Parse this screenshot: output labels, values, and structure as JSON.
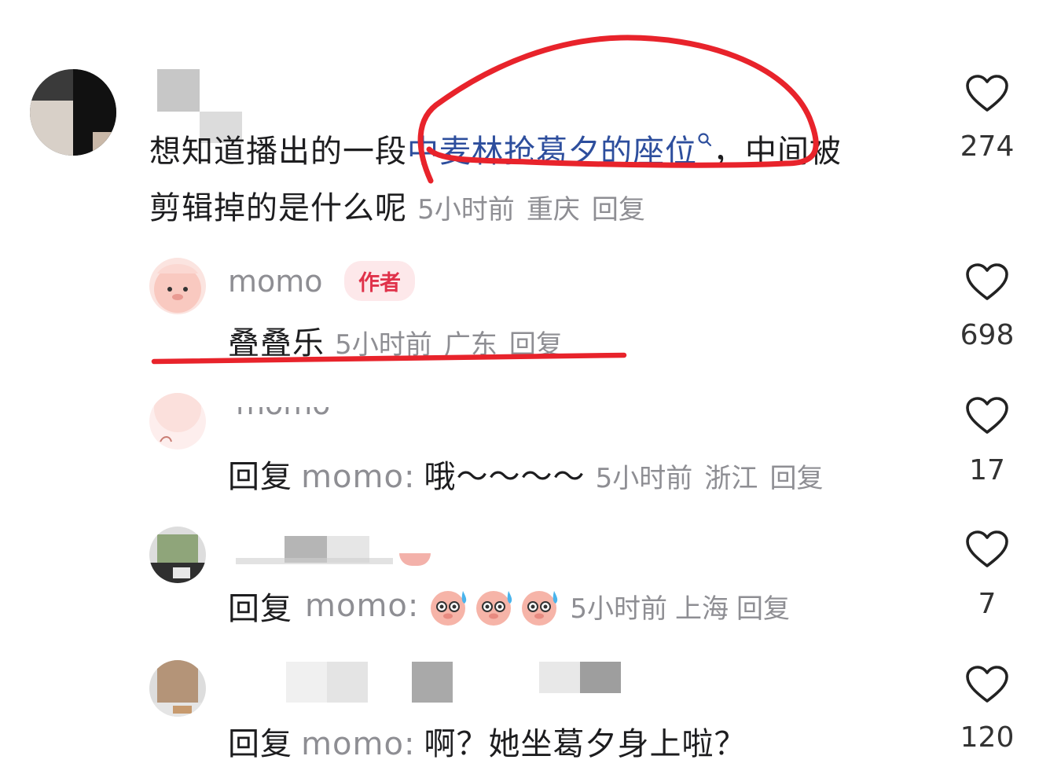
{
  "comments": [
    {
      "location": "重庆",
      "time": "5小时前",
      "reply_label": "回复",
      "text_before": "想知道播出的一段",
      "link_text": "中麦林抢葛夕的座位",
      "text_after": "，中间被",
      "text_line2": "剪辑掉的是什么呢",
      "likes": "274",
      "icon": "heart-outline-icon"
    },
    {
      "username": "momo",
      "badge": "作者",
      "text": "叠叠乐",
      "time": "5小时前",
      "location": "广东",
      "reply_label": "回复",
      "likes": "698",
      "icon": "heart-outline-icon"
    },
    {
      "username": "momo",
      "reply_prefix": "回复",
      "reply_to": "momo",
      "text": "哦～～～～",
      "time": "5小时前",
      "location": "浙江",
      "reply_label": "回复",
      "likes": "17",
      "icon": "heart-outline-icon"
    },
    {
      "reply_prefix": "回复",
      "reply_to": "momo",
      "emoji": [
        "sweat-smile-emoji",
        "sweat-smile-emoji",
        "sweat-smile-emoji"
      ],
      "time": "5小时前",
      "location": "上海",
      "reply_label": "回复",
      "likes": "7",
      "icon": "heart-outline-icon"
    },
    {
      "reply_prefix": "回复",
      "reply_to": "momo",
      "text": "啊？她坐葛夕身上啦？",
      "likes": "120",
      "icon": "heart-outline-icon"
    }
  ],
  "colors": {
    "annotation_red": "#e8232b",
    "link_blue": "#2d4e9d",
    "badge_bg": "#fde8ea",
    "badge_text": "#e0324a",
    "meta_gray": "#8e8e93"
  }
}
